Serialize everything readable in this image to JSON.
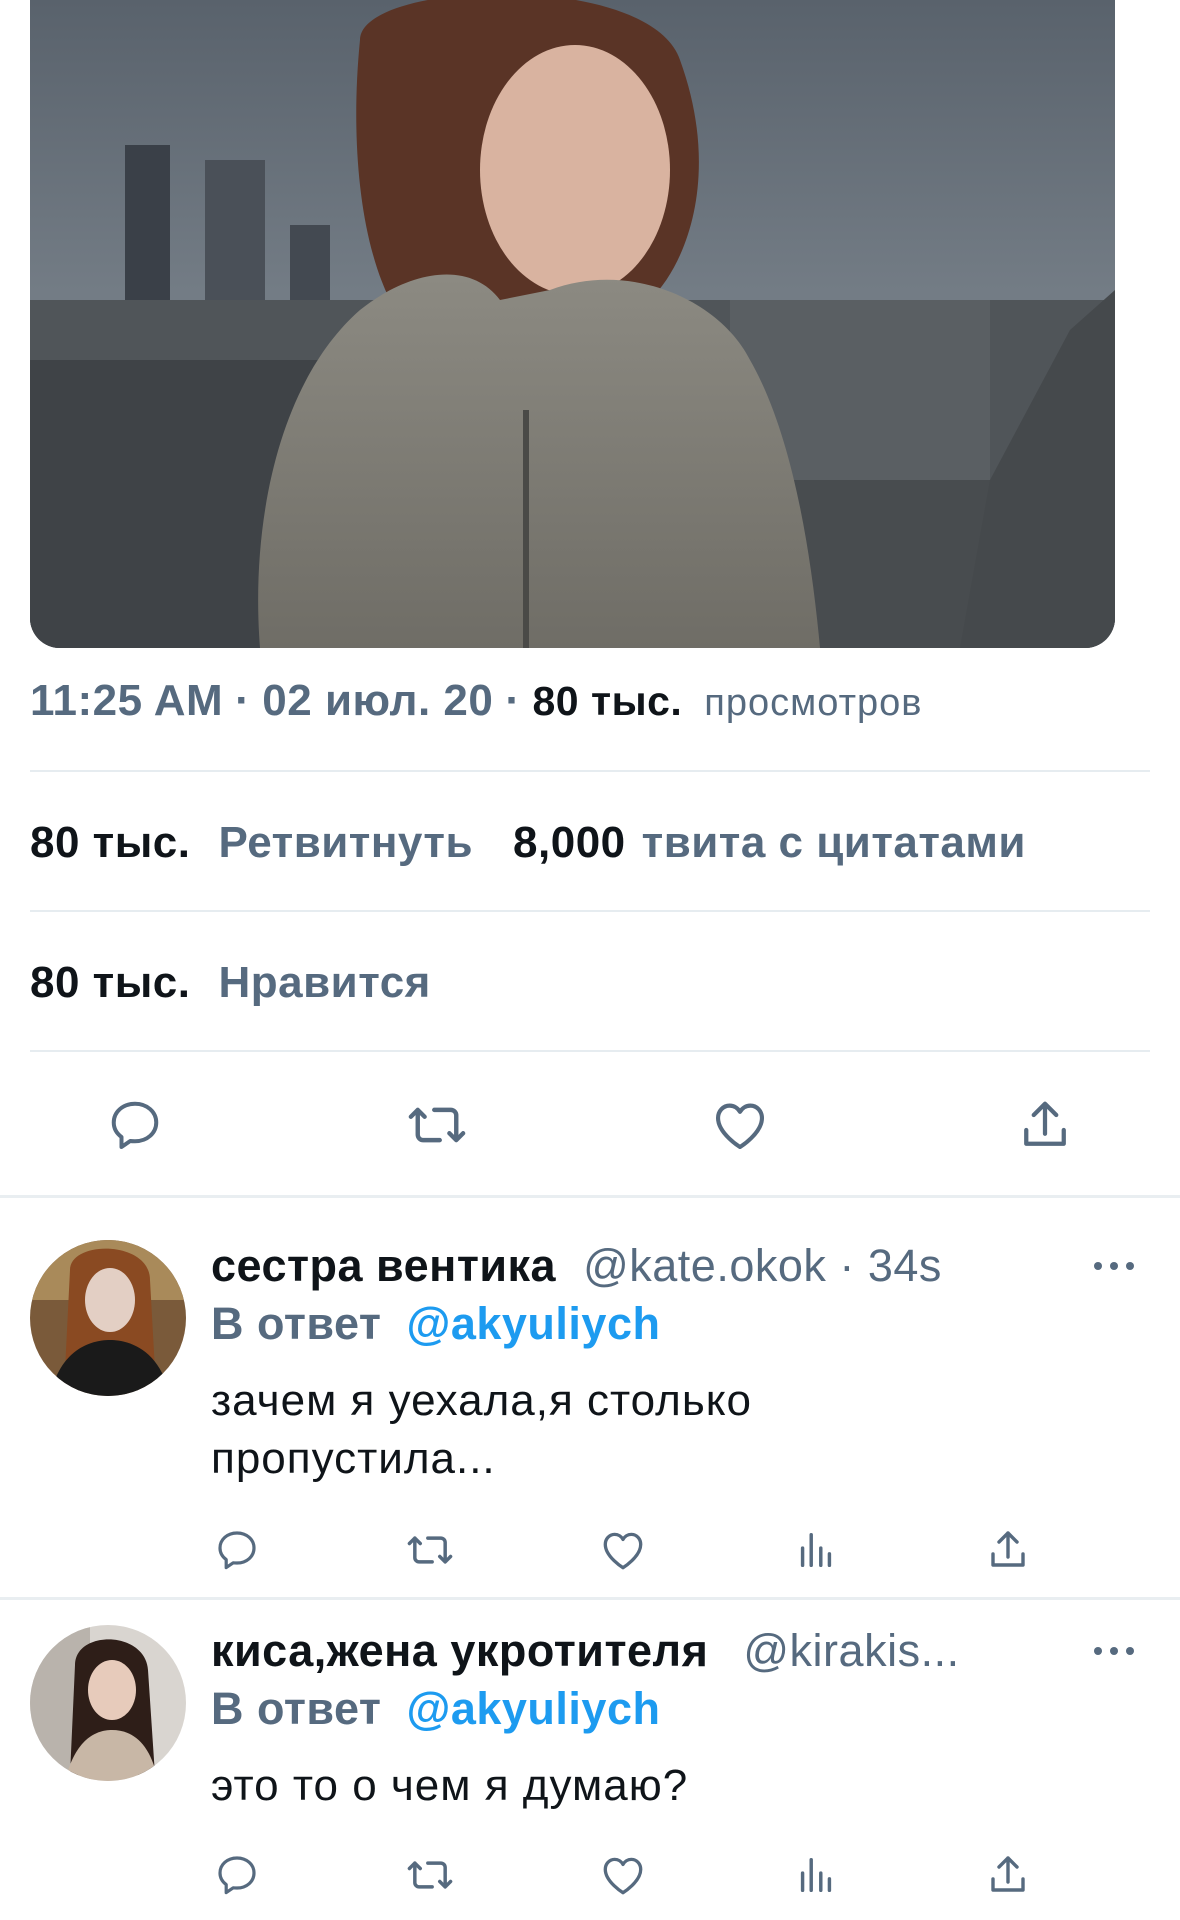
{
  "tweet": {
    "time": "11:25 AM",
    "separator": "·",
    "date": "02 июл. 20",
    "views_count": "80 тыс.",
    "views_label": "просмотров",
    "retweets_count": "80 тыс.",
    "retweets_label": "Ретвитнуть",
    "quotes_count": "8,000",
    "quotes_label": "твита с цитатами",
    "likes_count": "80 тыс.",
    "likes_label": "Нравится",
    "actions": [
      "reply-icon",
      "retweet-icon",
      "like-icon",
      "share-icon"
    ]
  },
  "replies": [
    {
      "name": "сестра вентика",
      "handle": "@kate.okok · 34s",
      "reply_label": "В ответ",
      "reply_handle": "@akyuliych",
      "text": "зачем я уехала,я столько пропустила...",
      "actions": [
        "reply-icon",
        "retweet-icon",
        "like-icon",
        "analytics-icon",
        "share-icon"
      ]
    },
    {
      "name": "киса,жена укротителя",
      "handle": "@kirakis...",
      "reply_label": "В ответ",
      "reply_handle": "@akyuliych",
      "text": "это то о чем я думаю?",
      "actions": [
        "reply-icon",
        "retweet-icon",
        "like-icon",
        "analytics-icon",
        "share-icon"
      ]
    }
  ],
  "colors": {
    "text_primary": "#0f1419",
    "text_secondary": "#566a7f",
    "link": "#1d9bf0",
    "divider": "#e6ecf0"
  }
}
